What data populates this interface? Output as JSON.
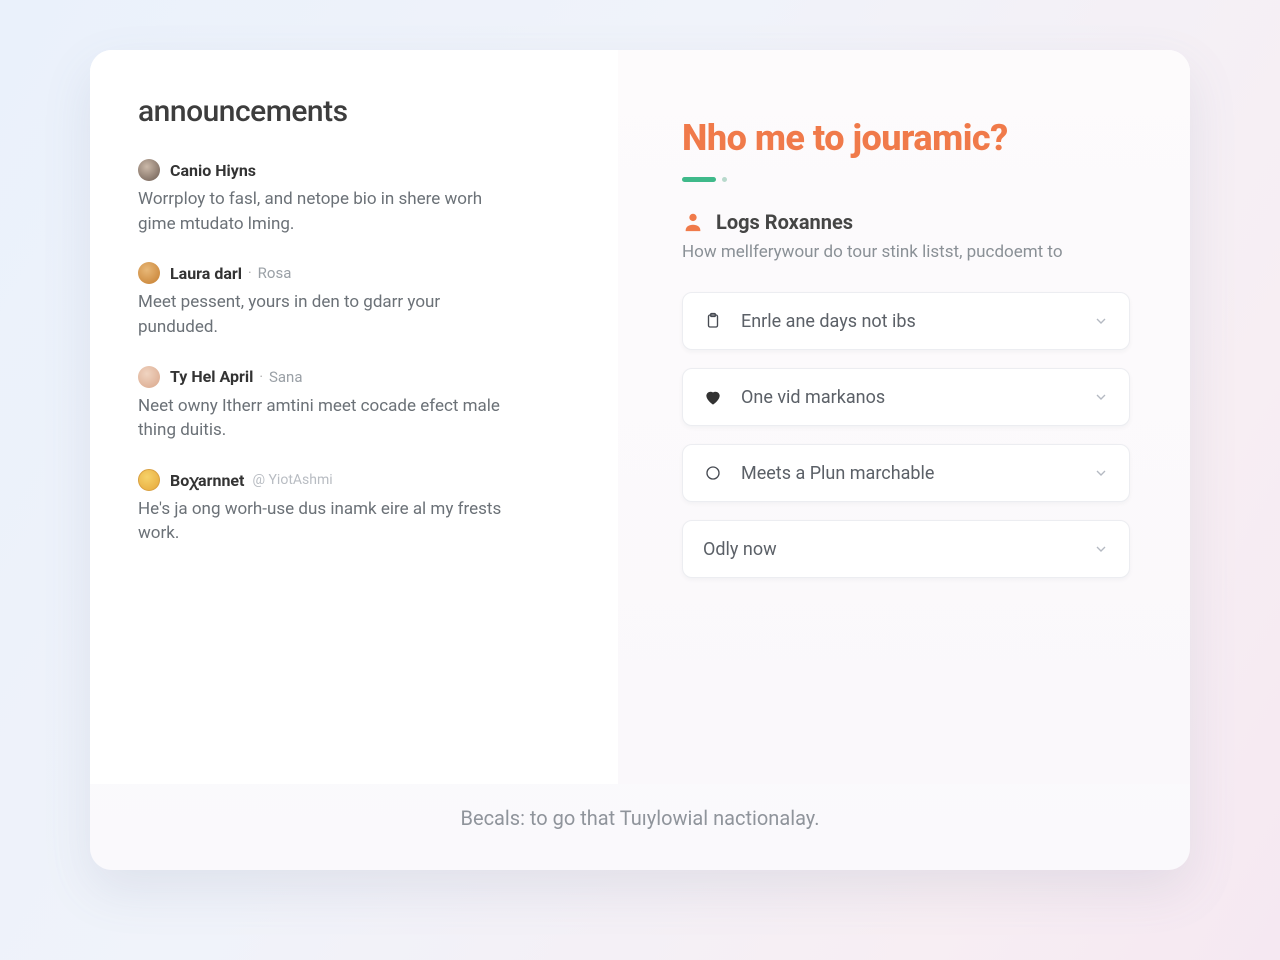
{
  "left_title": "announcements",
  "posts": [
    {
      "author": "Canio Hiyns",
      "meta": "",
      "body": "Worrploy to fasl, and netope bio in shere worh gime mtudato lming."
    },
    {
      "author": "Laura darl",
      "meta": "Rosa",
      "body": "Meet pessent, yours in den to gdarr your punduded."
    },
    {
      "author": "Ty Hel April",
      "meta": "Sana",
      "body": "Neet owny Itherr amtini meet cocade efect male thing duitis."
    },
    {
      "author": "Boꭓarnnet",
      "handle": "@ YiotAshmi",
      "body": "He's ja ong worh-use dus inamk eire al my frests work."
    }
  ],
  "headline": "Nho me to jouramic?",
  "sub_author": "Logs Roxannes",
  "sub_text": "How mellferywour do tour stink listst, pucdoemt to",
  "dropdowns": [
    {
      "icon": "clipboard",
      "label": "Enrle ane days not ibs"
    },
    {
      "icon": "heart",
      "label": "One vid markanos"
    },
    {
      "icon": "circle",
      "label": "Meets a Plun marchable"
    },
    {
      "icon": "",
      "label": "Odly now"
    }
  ],
  "footer": "Becals: to go that Tuıylowial nactionalay."
}
